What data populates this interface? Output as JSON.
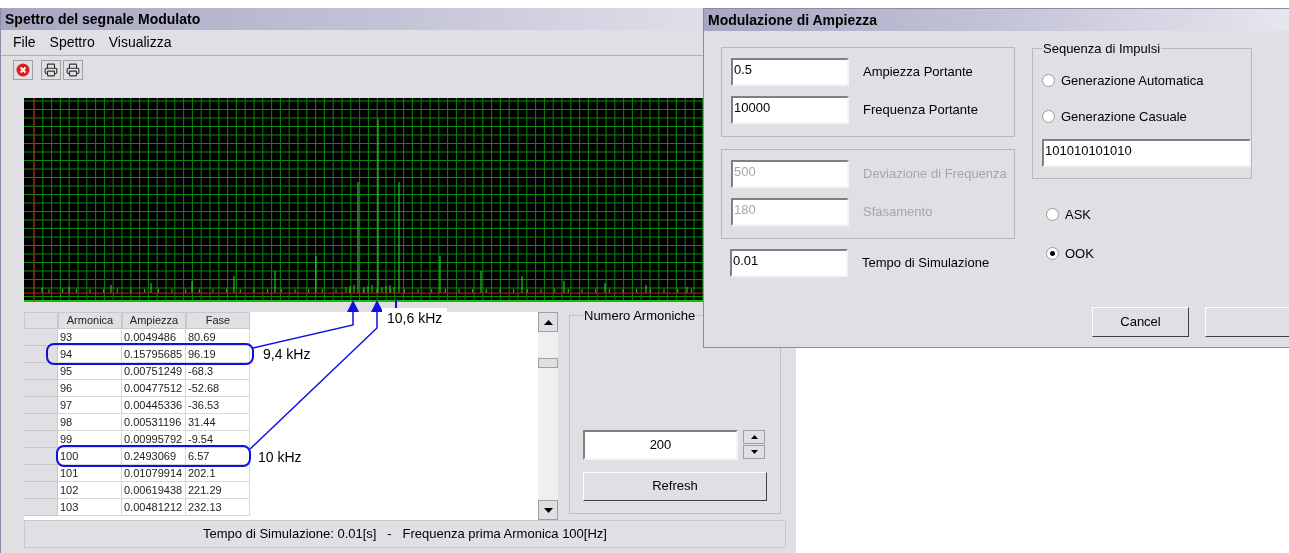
{
  "main_window": {
    "title": "Spettro del segnale Modulato",
    "menu": [
      {
        "label": "File"
      },
      {
        "label": "Spettro"
      },
      {
        "label": "Visualizza"
      }
    ],
    "table": {
      "columns": [
        "Armonica",
        "Ampiezza",
        "Fase"
      ],
      "rows": [
        {
          "cells": [
            "93",
            "0.0049486",
            "80.69"
          ],
          "circled": false
        },
        {
          "cells": [
            "94",
            "0.15795685",
            "96.19"
          ],
          "circled": true
        },
        {
          "cells": [
            "95",
            "0.00751249",
            "-68.3"
          ],
          "circled": false
        },
        {
          "cells": [
            "96",
            "0.00477512",
            "-52.68"
          ],
          "circled": false
        },
        {
          "cells": [
            "97",
            "0.00445336",
            "-36.53"
          ],
          "circled": false
        },
        {
          "cells": [
            "98",
            "0.00531196",
            "31.44"
          ],
          "circled": false
        },
        {
          "cells": [
            "99",
            "0.00995792",
            "-9.54"
          ],
          "circled": false
        },
        {
          "cells": [
            "100",
            "0.2493069",
            "6.57"
          ],
          "circled": true
        },
        {
          "cells": [
            "101",
            "0.01079914",
            "202.1"
          ],
          "circled": false
        },
        {
          "cells": [
            "102",
            "0.00619438",
            "221.29"
          ],
          "circled": false
        },
        {
          "cells": [
            "103",
            "0.00481212",
            "232.13"
          ],
          "circled": false
        }
      ]
    },
    "annotations": [
      "9,4 kHz",
      "10 kHz",
      "10,6 kHz"
    ],
    "harmonics_group": {
      "title": "Numero Armoniche",
      "value": "200",
      "button": "Refresh"
    },
    "status_bar": "Tempo di Simulazione: 0.01[s]   -   Frequenza prima Armonica 100[Hz]"
  },
  "dialog": {
    "title": "Modulazione di Ampiezza",
    "carrier_fields": [
      {
        "value": "0.5",
        "label": "Ampiezza Portante",
        "disabled": false
      },
      {
        "value": "10000",
        "label": "Frequenza Portante",
        "disabled": false
      }
    ],
    "fm_fields": [
      {
        "value": "500",
        "label": "Deviazione di Frequenza",
        "disabled": true
      },
      {
        "value": "180",
        "label": "Sfasamento",
        "disabled": true
      }
    ],
    "time_field": {
      "value": "0.01",
      "label": "Tempo di Simulazione",
      "disabled": false
    },
    "sequence_group": {
      "title": "Sequenza di Impulsi",
      "options": [
        {
          "label": "Generazione Automatica",
          "selected": false
        },
        {
          "label": "Generazione Casuale",
          "selected": false
        }
      ],
      "value": "101010101010"
    },
    "modulation_options": [
      {
        "label": "ASK",
        "selected": false
      },
      {
        "label": "OOK",
        "selected": true
      }
    ],
    "buttons": [
      "Cancel"
    ]
  }
}
